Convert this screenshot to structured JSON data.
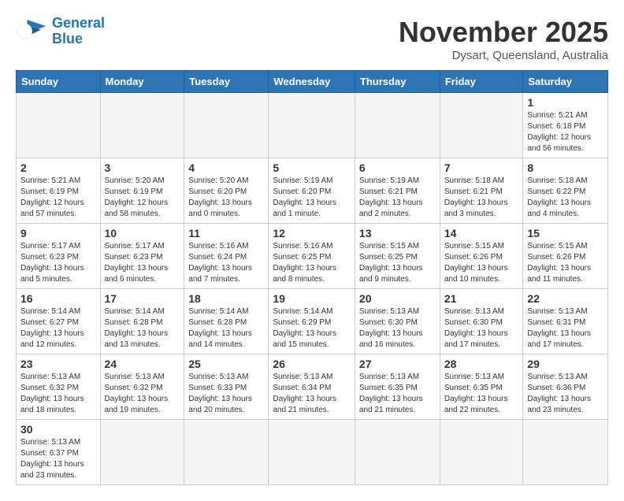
{
  "logo": {
    "line1": "General",
    "line2": "Blue"
  },
  "title": "November 2025",
  "subtitle": "Dysart, Queensland, Australia",
  "days_of_week": [
    "Sunday",
    "Monday",
    "Tuesday",
    "Wednesday",
    "Thursday",
    "Friday",
    "Saturday"
  ],
  "weeks": [
    [
      {
        "day": "",
        "info": ""
      },
      {
        "day": "",
        "info": ""
      },
      {
        "day": "",
        "info": ""
      },
      {
        "day": "",
        "info": ""
      },
      {
        "day": "",
        "info": ""
      },
      {
        "day": "",
        "info": ""
      },
      {
        "day": "1",
        "info": "Sunrise: 5:21 AM\nSunset: 6:18 PM\nDaylight: 12 hours\nand 56 minutes."
      }
    ],
    [
      {
        "day": "2",
        "info": "Sunrise: 5:21 AM\nSunset: 6:19 PM\nDaylight: 12 hours\nand 57 minutes."
      },
      {
        "day": "3",
        "info": "Sunrise: 5:20 AM\nSunset: 6:19 PM\nDaylight: 12 hours\nand 58 minutes."
      },
      {
        "day": "4",
        "info": "Sunrise: 5:20 AM\nSunset: 6:20 PM\nDaylight: 13 hours\nand 0 minutes."
      },
      {
        "day": "5",
        "info": "Sunrise: 5:19 AM\nSunset: 6:20 PM\nDaylight: 13 hours\nand 1 minute."
      },
      {
        "day": "6",
        "info": "Sunrise: 5:19 AM\nSunset: 6:21 PM\nDaylight: 13 hours\nand 2 minutes."
      },
      {
        "day": "7",
        "info": "Sunrise: 5:18 AM\nSunset: 6:21 PM\nDaylight: 13 hours\nand 3 minutes."
      },
      {
        "day": "8",
        "info": "Sunrise: 5:18 AM\nSunset: 6:22 PM\nDaylight: 13 hours\nand 4 minutes."
      }
    ],
    [
      {
        "day": "9",
        "info": "Sunrise: 5:17 AM\nSunset: 6:23 PM\nDaylight: 13 hours\nand 5 minutes."
      },
      {
        "day": "10",
        "info": "Sunrise: 5:17 AM\nSunset: 6:23 PM\nDaylight: 13 hours\nand 6 minutes."
      },
      {
        "day": "11",
        "info": "Sunrise: 5:16 AM\nSunset: 6:24 PM\nDaylight: 13 hours\nand 7 minutes."
      },
      {
        "day": "12",
        "info": "Sunrise: 5:16 AM\nSunset: 6:25 PM\nDaylight: 13 hours\nand 8 minutes."
      },
      {
        "day": "13",
        "info": "Sunrise: 5:15 AM\nSunset: 6:25 PM\nDaylight: 13 hours\nand 9 minutes."
      },
      {
        "day": "14",
        "info": "Sunrise: 5:15 AM\nSunset: 6:26 PM\nDaylight: 13 hours\nand 10 minutes."
      },
      {
        "day": "15",
        "info": "Sunrise: 5:15 AM\nSunset: 6:26 PM\nDaylight: 13 hours\nand 11 minutes."
      }
    ],
    [
      {
        "day": "16",
        "info": "Sunrise: 5:14 AM\nSunset: 6:27 PM\nDaylight: 13 hours\nand 12 minutes."
      },
      {
        "day": "17",
        "info": "Sunrise: 5:14 AM\nSunset: 6:28 PM\nDaylight: 13 hours\nand 13 minutes."
      },
      {
        "day": "18",
        "info": "Sunrise: 5:14 AM\nSunset: 6:28 PM\nDaylight: 13 hours\nand 14 minutes."
      },
      {
        "day": "19",
        "info": "Sunrise: 5:14 AM\nSunset: 6:29 PM\nDaylight: 13 hours\nand 15 minutes."
      },
      {
        "day": "20",
        "info": "Sunrise: 5:13 AM\nSunset: 6:30 PM\nDaylight: 13 hours\nand 16 minutes."
      },
      {
        "day": "21",
        "info": "Sunrise: 5:13 AM\nSunset: 6:30 PM\nDaylight: 13 hours\nand 17 minutes."
      },
      {
        "day": "22",
        "info": "Sunrise: 5:13 AM\nSunset: 6:31 PM\nDaylight: 13 hours\nand 17 minutes."
      }
    ],
    [
      {
        "day": "23",
        "info": "Sunrise: 5:13 AM\nSunset: 6:32 PM\nDaylight: 13 hours\nand 18 minutes."
      },
      {
        "day": "24",
        "info": "Sunrise: 5:13 AM\nSunset: 6:32 PM\nDaylight: 13 hours\nand 19 minutes."
      },
      {
        "day": "25",
        "info": "Sunrise: 5:13 AM\nSunset: 6:33 PM\nDaylight: 13 hours\nand 20 minutes."
      },
      {
        "day": "26",
        "info": "Sunrise: 5:13 AM\nSunset: 6:34 PM\nDaylight: 13 hours\nand 21 minutes."
      },
      {
        "day": "27",
        "info": "Sunrise: 5:13 AM\nSunset: 6:35 PM\nDaylight: 13 hours\nand 21 minutes."
      },
      {
        "day": "28",
        "info": "Sunrise: 5:13 AM\nSunset: 6:35 PM\nDaylight: 13 hours\nand 22 minutes."
      },
      {
        "day": "29",
        "info": "Sunrise: 5:13 AM\nSunset: 6:36 PM\nDaylight: 13 hours\nand 23 minutes."
      }
    ],
    [
      {
        "day": "30",
        "info": "Sunrise: 5:13 AM\nSunset: 6:37 PM\nDaylight: 13 hours\nand 23 minutes."
      },
      {
        "day": "",
        "info": ""
      },
      {
        "day": "",
        "info": ""
      },
      {
        "day": "",
        "info": ""
      },
      {
        "day": "",
        "info": ""
      },
      {
        "day": "",
        "info": ""
      },
      {
        "day": "",
        "info": ""
      }
    ]
  ]
}
